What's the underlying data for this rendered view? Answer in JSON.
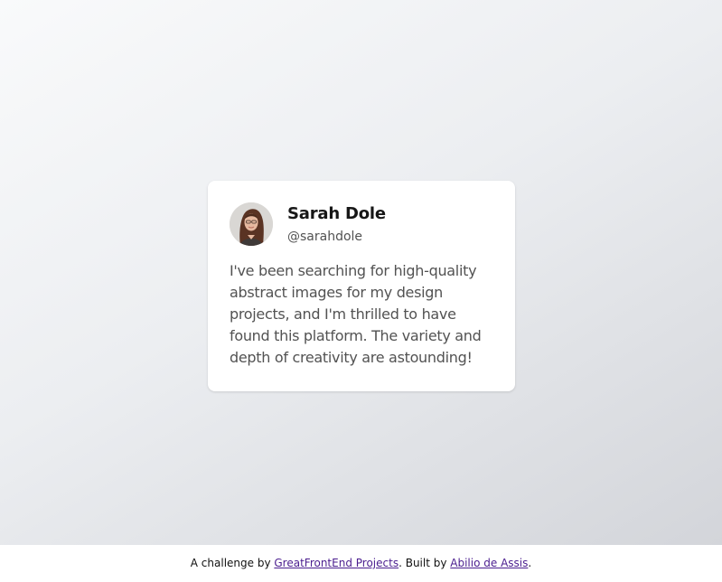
{
  "testimonial": {
    "name": "Sarah Dole",
    "handle": "@sarahdole",
    "quote": "I've been searching for high-quality abstract images for my design projects, and I'm thrilled to have found this platform. The variety and depth of creativity are astounding!",
    "avatar_alt": "Sarah Dole"
  },
  "footer": {
    "prefix": "A challenge by ",
    "link1_label": "GreatFrontEnd Projects",
    "middle": ". Built by ",
    "link2_label": "Abilio de Assis",
    "suffix": "."
  },
  "colors": {
    "background_start": "#f9fafb",
    "background_end": "#d3d5da",
    "card": "#ffffff",
    "name_text": "#171717",
    "body_text": "#525252",
    "link": "#4b1e8f"
  }
}
